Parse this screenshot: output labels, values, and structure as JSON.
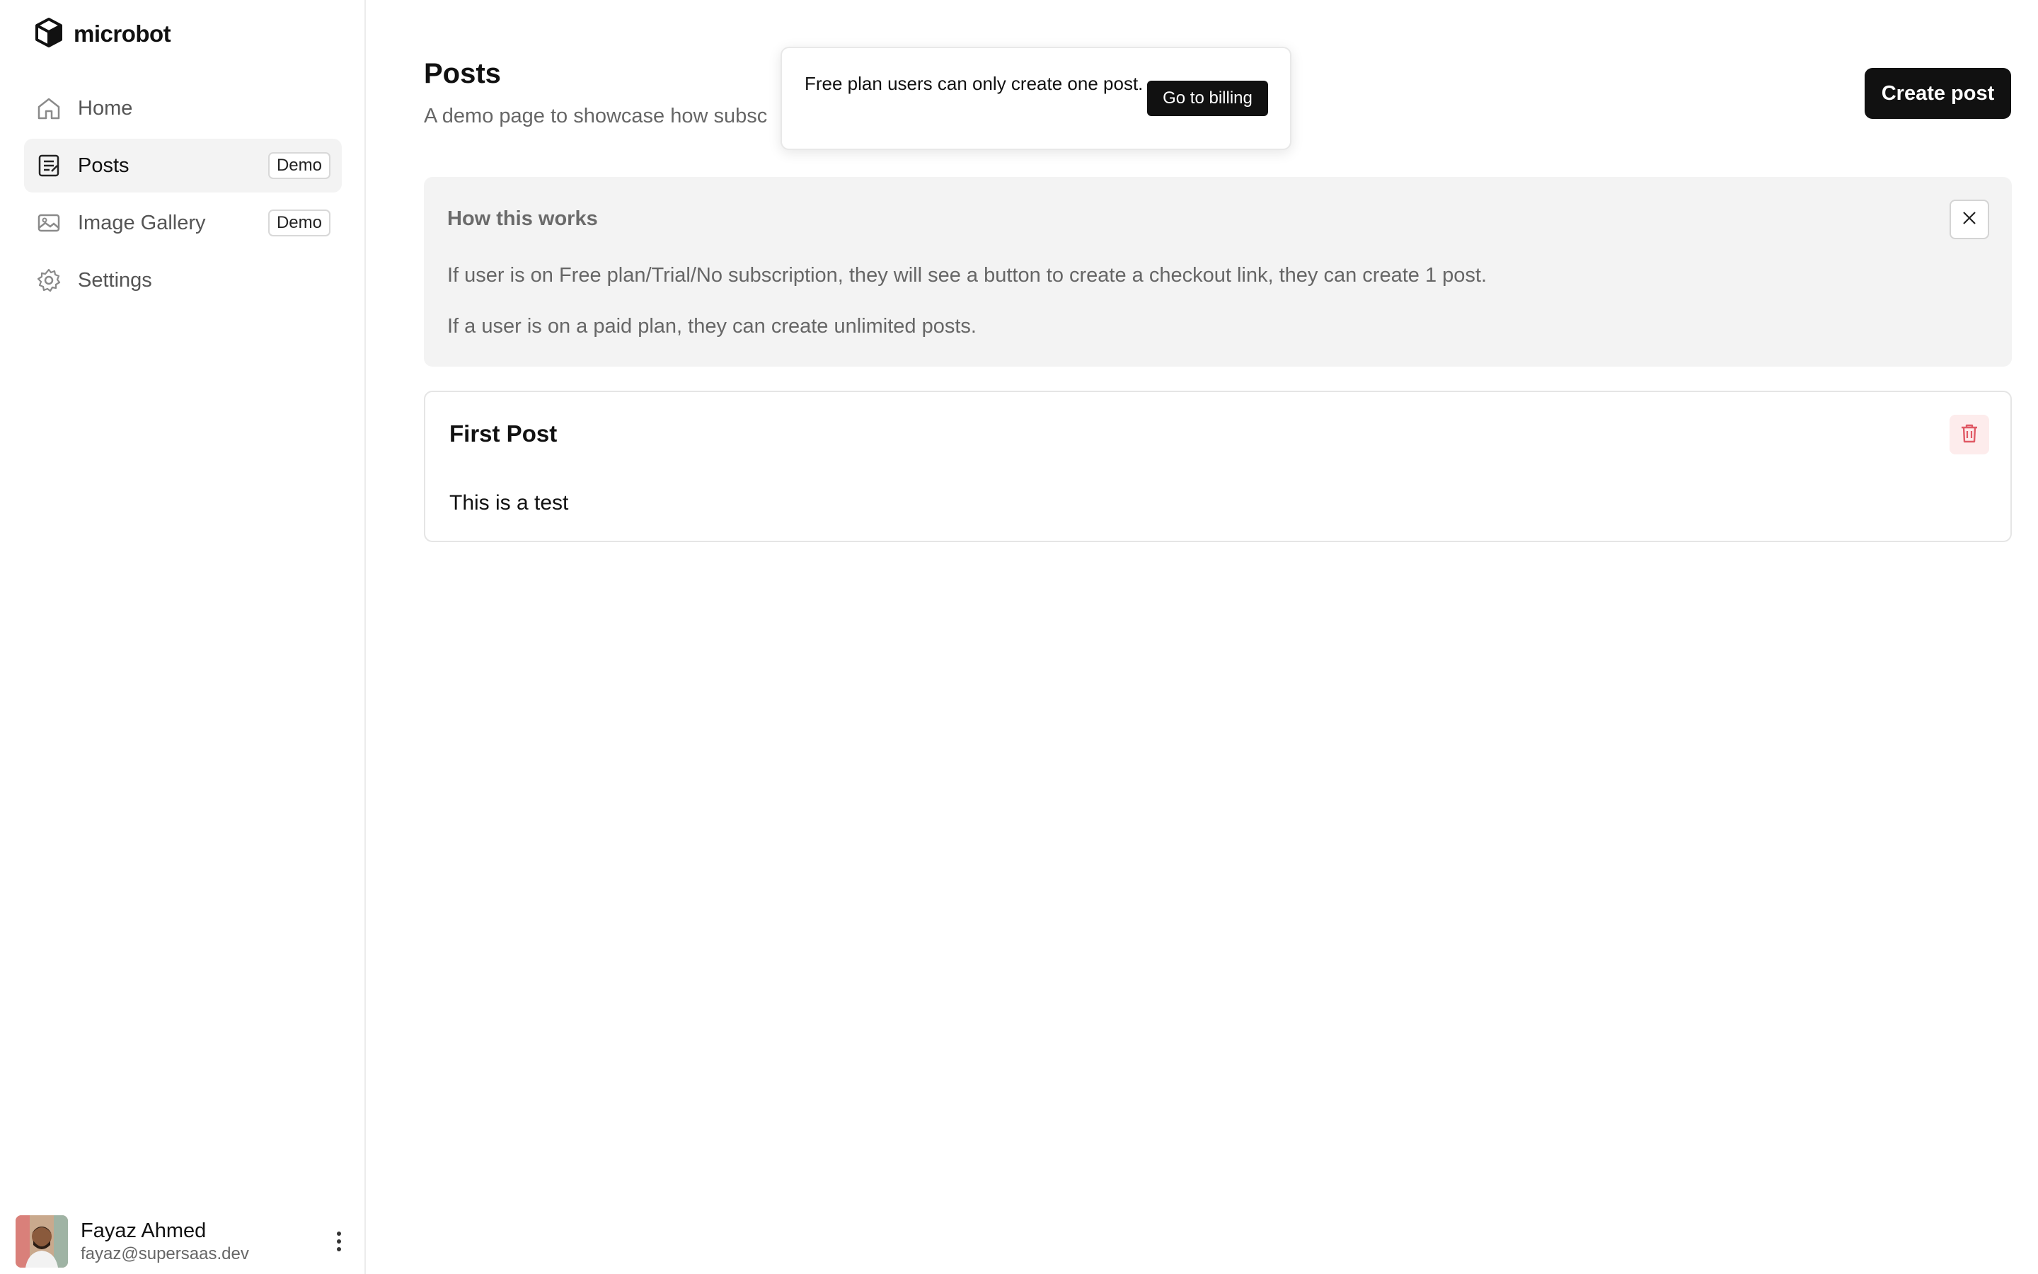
{
  "app": {
    "name": "microbot"
  },
  "sidebar": {
    "items": [
      {
        "label": "Home",
        "icon": "home-icon",
        "active": false,
        "badge": ""
      },
      {
        "label": "Posts",
        "icon": "notepad-icon",
        "active": true,
        "badge": "Demo"
      },
      {
        "label": "Image Gallery",
        "icon": "image-icon",
        "active": false,
        "badge": "Demo"
      },
      {
        "label": "Settings",
        "icon": "gear-icon",
        "active": false,
        "badge": ""
      }
    ],
    "user": {
      "name": "Fayaz Ahmed",
      "email": "fayaz@supersaas.dev"
    }
  },
  "header": {
    "title": "Posts",
    "subtitle": "A demo page to showcase how subsc",
    "create_label": "Create post"
  },
  "info": {
    "title": "How this works",
    "p1": "If user is on Free plan/Trial/No subscription, they will see a button to create a checkout link, they can create 1 post.",
    "p2": "If a user is on a paid plan, they can create unlimited posts."
  },
  "posts": [
    {
      "title": "First Post",
      "body": "This is a test"
    }
  ],
  "toast": {
    "message": "Free plan users can only create one post.",
    "action_label": "Go to billing"
  },
  "colors": {
    "primary": "#111111",
    "danger": "#e05a66",
    "muted": "#666666"
  }
}
